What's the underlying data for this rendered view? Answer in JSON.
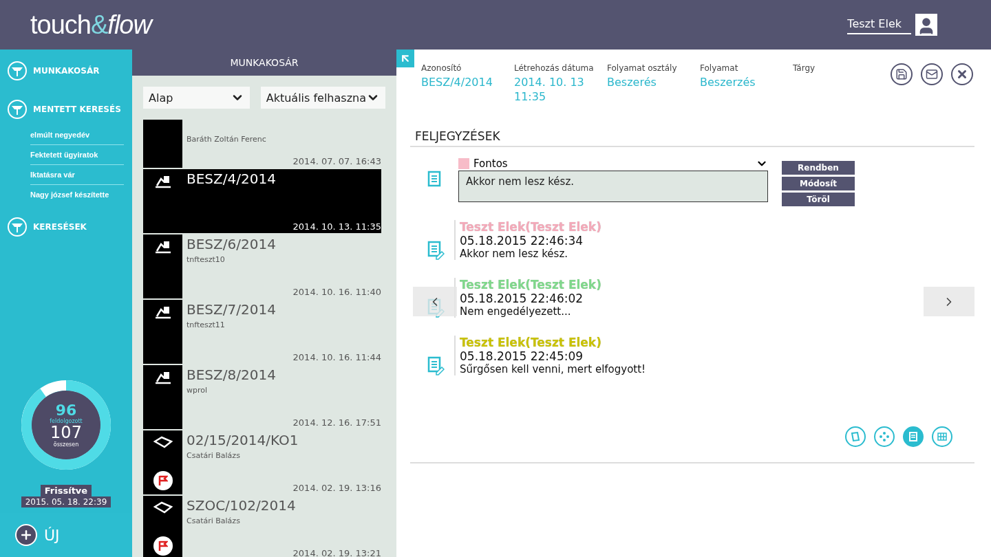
{
  "header": {
    "logo": {
      "part1": "touch",
      "part2": "&",
      "part3": "flow"
    },
    "user": "Teszt Elek"
  },
  "sidebar": {
    "sections": [
      {
        "label": "MUNKAKOSÁR"
      },
      {
        "label": "MENTETT KERESÉS",
        "children": [
          {
            "label": "elmúlt negyedév"
          },
          {
            "label": "Fektetett ügyiratok"
          },
          {
            "label": "Iktatásra vár"
          },
          {
            "label": "Nagy józsef készítette"
          }
        ]
      },
      {
        "label": "KERESÉSEK"
      }
    ],
    "stats": {
      "processed": "96",
      "processed_label": "feldolgozott",
      "total": "107",
      "total_label": "összesen",
      "level": 0.9
    },
    "refresh": {
      "label": "Frissítve",
      "time": "2015. 05. 18. 22:39"
    },
    "new_button": "ÚJ"
  },
  "list": {
    "title": "MUNKAKOSÁR",
    "filters": [
      {
        "value": "Alap"
      },
      {
        "value": "Aktuális felhaszna"
      }
    ],
    "items": [
      {
        "kind": "plain",
        "subtitle": "Baráth Zoltán Ferenc",
        "date": "2014. 07. 07. 16:43",
        "flag": false,
        "selected": false
      },
      {
        "kind": "scale",
        "title": "BESZ/4/2014",
        "date": "2014. 10. 13. 11:35",
        "flag": false,
        "selected": true
      },
      {
        "kind": "scale",
        "title": "BESZ/6/2014",
        "subtitle": "tnfteszt10",
        "date": "2014. 10. 16. 11:40",
        "flag": false,
        "selected": false
      },
      {
        "kind": "scale",
        "title": "BESZ/7/2014",
        "subtitle": "tnfteszt11",
        "date": "2014. 10. 16. 11:44",
        "flag": false,
        "selected": false
      },
      {
        "kind": "scale",
        "title": "BESZ/8/2014",
        "subtitle": "wprol",
        "date": "2014. 12. 16. 17:51",
        "flag": false,
        "selected": false
      },
      {
        "kind": "book",
        "title": "02/15/2014/KO1",
        "subtitle": "Csatári Balázs",
        "date": "2014. 02. 19. 13:16",
        "flag": true,
        "selected": false
      },
      {
        "kind": "book",
        "title": "SZOC/102/2014",
        "subtitle": "Csatári Balázs",
        "date": "2014. 02. 19. 13:21",
        "flag": true,
        "selected": false
      }
    ]
  },
  "detail": {
    "fields": [
      {
        "label": "Azonosító",
        "value": "BESZ/4/2014"
      },
      {
        "label": "Létrehozás dátuma",
        "value": "2014. 10. 13 11:35"
      },
      {
        "label": "Folyamat osztály",
        "value": "Beszerés"
      },
      {
        "label": "Folyamat",
        "value": "Beszerzés"
      },
      {
        "label": "Tárgy"
      }
    ],
    "section_title": "FELJEGYZÉSEK",
    "editor": {
      "tag": {
        "label": "Fontos",
        "color": "#f7bcc8"
      },
      "text": "Akkor nem lesz kész.",
      "buttons": [
        "Rendben",
        "Módosít",
        "Töröl"
      ]
    },
    "notes": [
      {
        "author": "Teszt Elek(Teszt Elek)",
        "color": "#f4a9b9",
        "time": "05.18.2015 22:46:34",
        "text": "Akkor nem lesz kész."
      },
      {
        "author": "Teszt Elek(Teszt Elek)",
        "color": "#7fd88b",
        "time": "05.18.2015 22:46:02",
        "text": "Nem engedélyezett..."
      },
      {
        "author": "Teszt Elek(Teszt Elek)",
        "color": "#c9c200",
        "time": "05.18.2015 22:45:09",
        "text": "Sűrgősen kell venni, mert elfogyott!"
      }
    ],
    "bottom_icons": [
      {
        "kind": "doc",
        "selected": false
      },
      {
        "kind": "dots",
        "selected": false
      },
      {
        "kind": "note",
        "selected": true
      },
      {
        "kind": "grid",
        "selected": false
      }
    ]
  }
}
